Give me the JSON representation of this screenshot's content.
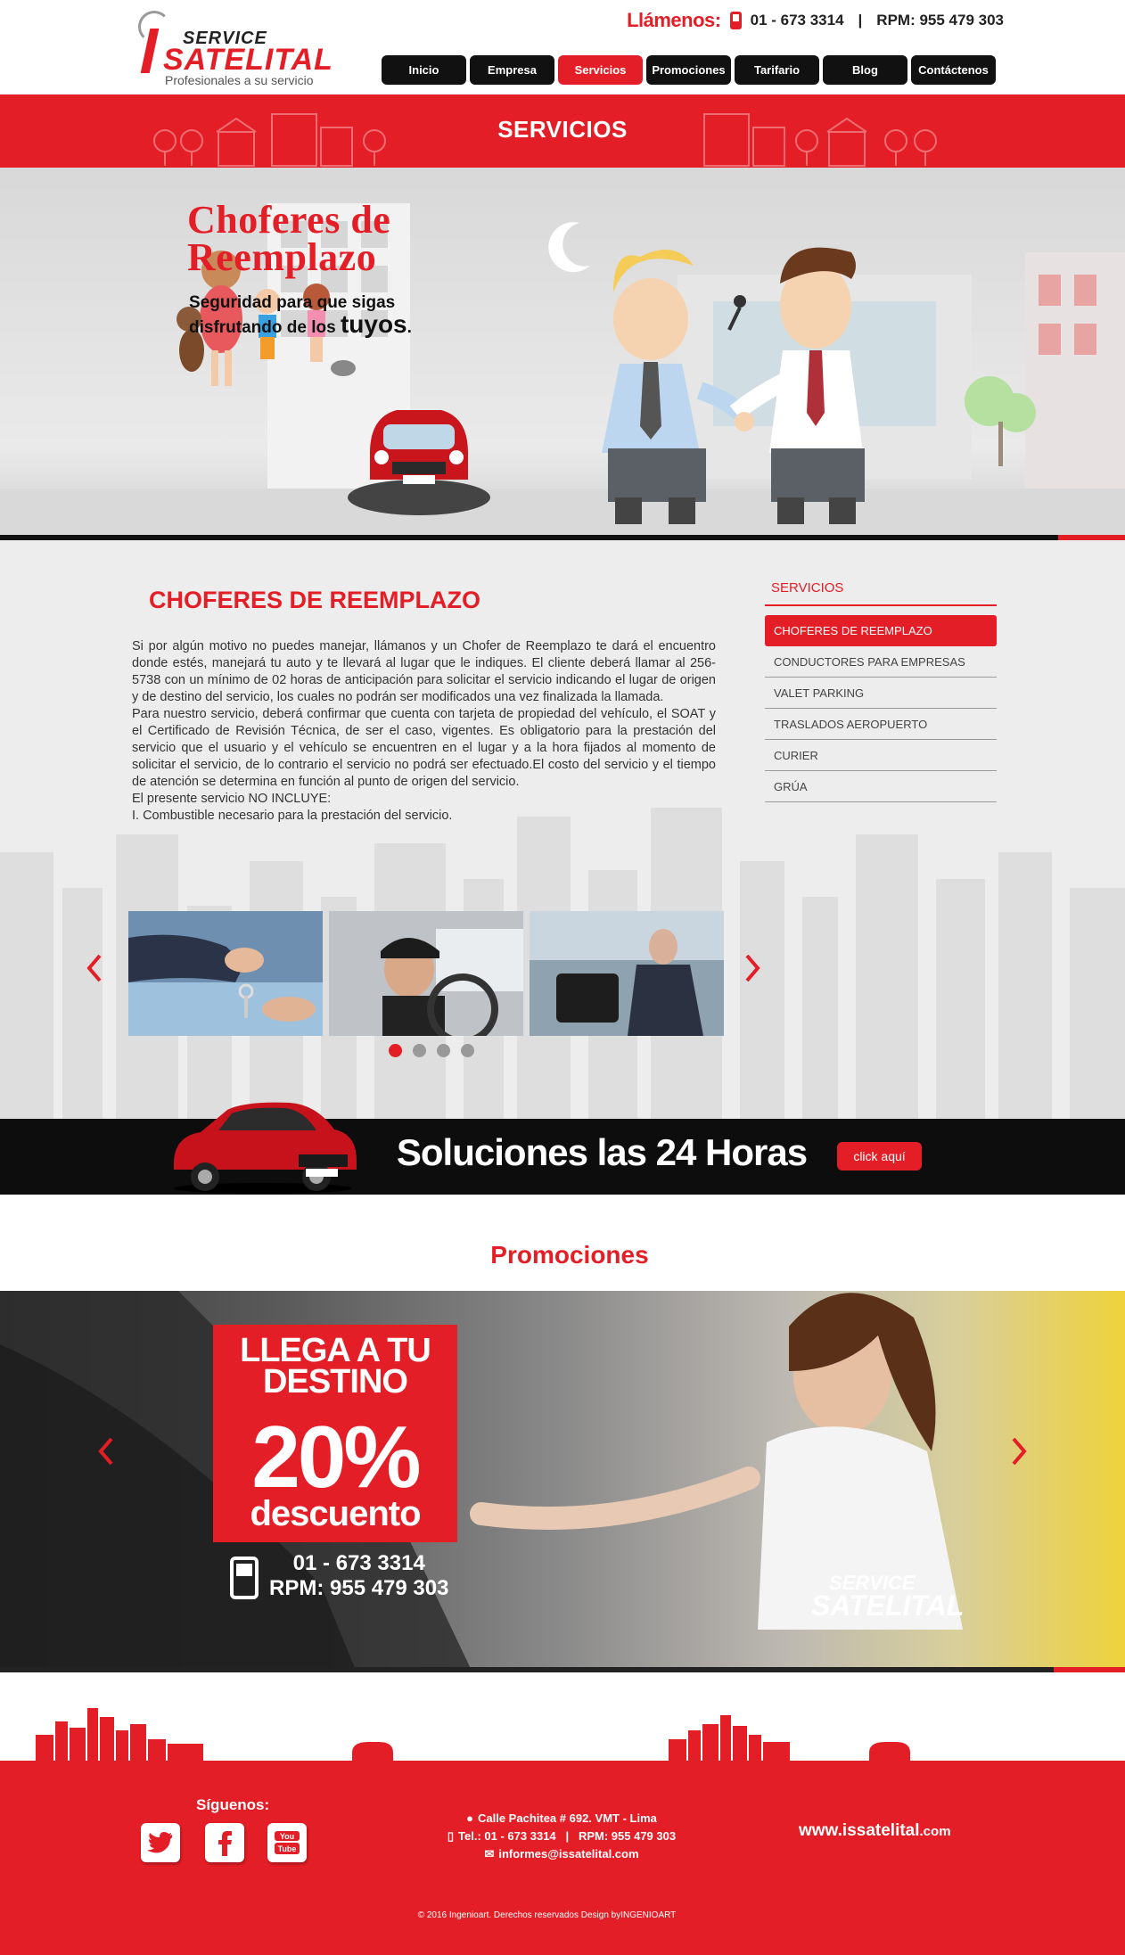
{
  "header": {
    "logo_service": "SERVICE",
    "logo_satelital": "SATELITAL",
    "tagline": "Profesionales a su servicio",
    "llamenos": "Llámenos:",
    "phone": "01 - 673 3314",
    "separator": "|",
    "rpm": "RPM: 955 479 303"
  },
  "nav": {
    "items": [
      {
        "label": "Inicio"
      },
      {
        "label": "Empresa"
      },
      {
        "label": "Servicios"
      },
      {
        "label": "Promociones"
      },
      {
        "label": "Tarifario"
      },
      {
        "label": "Blog"
      },
      {
        "label": "Contáctenos"
      }
    ],
    "active_index": 2
  },
  "banner": {
    "title": "SERVICIOS"
  },
  "hero": {
    "title_line1": "Choferes de",
    "title_line2": "Reemplazo",
    "sub_line1": "Seguridad para que sigas",
    "sub_line2": "disfrutando de los ",
    "sub_big": "tuyos",
    "sub_end": "."
  },
  "main": {
    "title": "CHOFERES DE REEMPLAZO",
    "paragraphs": [
      "Si por algún motivo no puedes manejar, llámanos y un Chofer de Reemplazo te dará el encuentro donde estés, manejará tu auto y te llevará al lugar que le indiques. El cliente deberá llamar al 256-5738 con un mínimo de 02 horas de anticipación para solicitar el servicio indicando el lugar de origen y de destino del servicio, los cuales no podrán ser modificados una vez finalizada la llamada.",
      "Para nuestro servicio, deberá confirmar que cuenta con tarjeta de propiedad del vehículo, el SOAT y el Certificado de Revisión Técnica, de ser el caso, vigentes. Es obligatorio para la prestación del servicio que el usuario y el vehículo se encuentren en el lugar y a la hora fijados al momento de solicitar el servicio, de lo contrario el servicio no podrá ser efectuado.El costo del servicio y el tiempo de atención se determina en función al punto de origen del servicio.",
      "El presente servicio NO INCLUYE:",
      "I. Combustible necesario para la prestación del servicio."
    ]
  },
  "sidebar": {
    "title": "SERVICIOS",
    "items": [
      {
        "label": "CHOFERES DE REEMPLAZO"
      },
      {
        "label": "CONDUCTORES PARA EMPRESAS"
      },
      {
        "label": "VALET PARKING"
      },
      {
        "label": "TRASLADOS AEROPUERTO"
      },
      {
        "label": "CURIER"
      },
      {
        "label": "GRÚA"
      }
    ],
    "active_index": 0
  },
  "carousel": {
    "dot_count": 4,
    "active_dot": 0
  },
  "strip": {
    "text": "Soluciones las 24 Horas",
    "button": "click aquí"
  },
  "promociones": {
    "title": "Promociones",
    "line1": "LLEGA A TU",
    "line2": "DESTINO",
    "percent": "20%",
    "descuento": "descuento",
    "phone": "01 - 673 3314",
    "rpm": "RPM: 955 479 303",
    "logo_service": "SERVICE",
    "logo_satelital": "SATELITAL"
  },
  "footer": {
    "siguenos": "Síguenos:",
    "address": "Calle Pachitea # 692. VMT - Lima",
    "phones": "Tel.: 01 - 673 3314   |   RPM: 955 479 303",
    "email": "informes@issatelital.com",
    "website_main": "www.issatelital",
    "website_ext": ".com",
    "copyright": "© 2016 Ingenioart. Derechos reservados  Design byINGENIOART"
  },
  "colors": {
    "brand_red": "#e41e26",
    "dark": "#111111",
    "content_bg": "#ededed"
  }
}
